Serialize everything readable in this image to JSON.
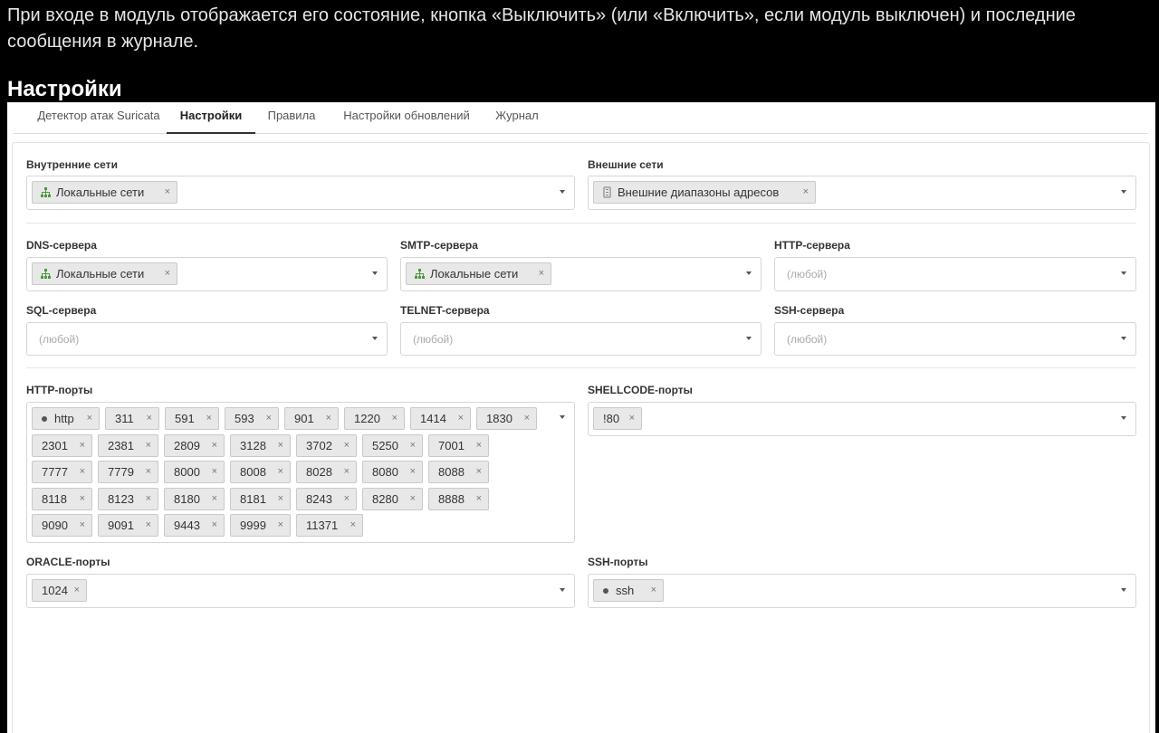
{
  "intro": "При входе в модуль отображается его состояние, кнопка «Выключить» (или «Включить», если модуль выключен) и последние сообщения в журнале.",
  "heading": "Настройки",
  "tabs": [
    "Детектор атак Suricata",
    "Настройки",
    "Правила",
    "Настройки обновлений",
    "Журнал"
  ],
  "remove_symbol": "×",
  "placeholder": "(любой)",
  "internal_networks": {
    "label": "Внутренние сети",
    "tags": [
      "Локальные сети"
    ]
  },
  "external_networks": {
    "label": "Внешние сети",
    "tags": [
      "Внешние диапазоны адресов"
    ]
  },
  "dns": {
    "label": "DNS-сервера",
    "tags": [
      "Локальные сети"
    ]
  },
  "smtp": {
    "label": "SMTP-сервера",
    "tags": [
      "Локальные сети"
    ]
  },
  "http_servers": {
    "label": "HTTP-сервера"
  },
  "sql": {
    "label": "SQL-сервера"
  },
  "telnet": {
    "label": "TELNET-сервера"
  },
  "ssh_servers": {
    "label": "SSH-сервера"
  },
  "http_ports": {
    "label": "HTTP-порты",
    "tags": [
      "http",
      "311",
      "591",
      "593",
      "901",
      "1220",
      "1414",
      "1830",
      "2301",
      "2381",
      "2809",
      "3128",
      "3702",
      "5250",
      "7001",
      "7777",
      "7779",
      "8000",
      "8008",
      "8028",
      "8080",
      "8088",
      "8118",
      "8123",
      "8180",
      "8181",
      "8243",
      "8280",
      "8888",
      "9090",
      "9091",
      "9443",
      "9999",
      "11371"
    ]
  },
  "shellcode_ports": {
    "label": "SHELLCODE-порты",
    "tags": [
      "!80"
    ]
  },
  "oracle_ports": {
    "label": "ORACLE-порты",
    "tags": [
      "1024"
    ]
  },
  "ssh_ports": {
    "label": "SSH-порты",
    "tags": [
      "ssh"
    ]
  },
  "colors": {
    "network_icon": "#4a9a3a",
    "range_icon": "#8a8a8a"
  }
}
